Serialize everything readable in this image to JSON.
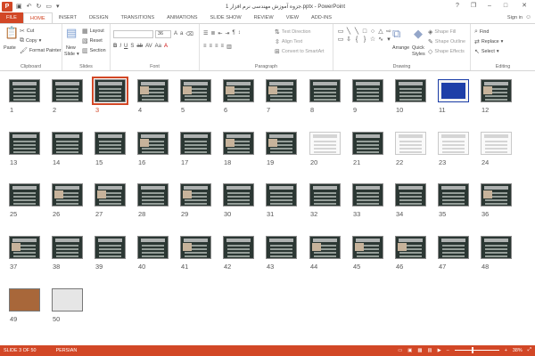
{
  "window": {
    "app_icon": "P",
    "title": "جزوه آموزش مهندسی نرم افزار 1.pptx - PowerPoint",
    "qat": [
      "save-icon",
      "undo-icon",
      "redo-icon",
      "start-icon"
    ],
    "controls": [
      "?",
      "❐",
      "–",
      "□",
      "✕"
    ]
  },
  "tabs": [
    {
      "label": "FILE",
      "kind": "file"
    },
    {
      "label": "HOME",
      "kind": "active"
    },
    {
      "label": "INSERT"
    },
    {
      "label": "DESIGN"
    },
    {
      "label": "TRANSITIONS"
    },
    {
      "label": "ANIMATIONS"
    },
    {
      "label": "SLIDE SHOW"
    },
    {
      "label": "REVIEW"
    },
    {
      "label": "VIEW"
    },
    {
      "label": "ADD-INS"
    }
  ],
  "signin": "Sign in",
  "ribbon": {
    "clipboard": {
      "label": "Clipboard",
      "paste": "Paste",
      "cut": "Cut",
      "copy": "Copy",
      "format_painter": "Format Painter"
    },
    "slides": {
      "label": "Slides",
      "new_slide": "New",
      "new_slide2": "Slide",
      "layout": "Layout",
      "reset": "Reset",
      "section": "Section"
    },
    "font": {
      "label": "Font",
      "size": "36"
    },
    "paragraph": {
      "label": "Paragraph",
      "text_direction": "Text Direction",
      "align_text": "Align Text",
      "smartart": "Convert to SmartArt"
    },
    "drawing": {
      "label": "Drawing",
      "arrange": "Arrange",
      "quick": "Quick",
      "styles": "Styles",
      "shape_fill": "Shape Fill",
      "shape_outline": "Shape Outline",
      "shape_effects": "Shape Effects"
    },
    "editing": {
      "label": "Editing",
      "find": "Find",
      "replace": "Replace",
      "select": "Select"
    }
  },
  "slides": {
    "count": 50,
    "selected": 3,
    "numbers": [
      "1",
      "2",
      "3",
      "4",
      "5",
      "6",
      "7",
      "8",
      "9",
      "10",
      "11",
      "12",
      "13",
      "14",
      "15",
      "16",
      "17",
      "18",
      "19",
      "20",
      "21",
      "22",
      "23",
      "24",
      "25",
      "26",
      "27",
      "28",
      "29",
      "30",
      "31",
      "32",
      "33",
      "34",
      "35",
      "36",
      "37",
      "38",
      "39",
      "40",
      "41",
      "42",
      "43",
      "44",
      "45",
      "46",
      "47",
      "48",
      "49",
      "50"
    ]
  },
  "status": {
    "slide": "SLIDE 3 OF 50",
    "language": "PERSIAN",
    "zoom": "38%",
    "zoom_level": 0.38
  },
  "colors": {
    "accent": "#d24726",
    "slide_bg": "#2b3733"
  }
}
